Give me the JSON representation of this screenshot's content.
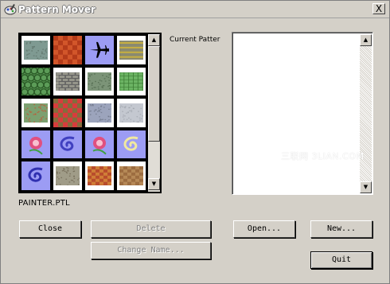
{
  "window": {
    "title": "Pattern Mover",
    "close_glyph": "X"
  },
  "patterns": {
    "items": [
      {
        "name": "stone-texture",
        "color": "#7f9a92",
        "accent": "#5d7068",
        "style": "speckle",
        "full": false
      },
      {
        "name": "red-rope",
        "color": "#d2562a",
        "accent": "#a02a10",
        "style": "weave",
        "full": true
      },
      {
        "name": "airplane-on-blue",
        "color": "#9c9cf4",
        "accent": "#000000",
        "style": "plane",
        "full": true
      },
      {
        "name": "road-stripes",
        "color": "#8a8a70",
        "accent": "#c8b040",
        "style": "stripes",
        "full": false
      },
      {
        "name": "green-scales",
        "color": "#5c9c58",
        "accent": "#2c5c28",
        "style": "scales",
        "full": true
      },
      {
        "name": "grey-bricks",
        "color": "#9c9c90",
        "accent": "#606060",
        "style": "bricks",
        "full": false
      },
      {
        "name": "grey-green-noise",
        "color": "#7c9478",
        "accent": "#4c6448",
        "style": "speckle",
        "full": false
      },
      {
        "name": "green-grid",
        "color": "#6cb464",
        "accent": "#3c7c34",
        "style": "grid",
        "full": false
      },
      {
        "name": "leaves-green",
        "color": "#7ca070",
        "accent": "#c85030",
        "style": "speckle",
        "full": false
      },
      {
        "name": "red-flowers",
        "color": "#d83c3c",
        "accent": "#4c8c3c",
        "style": "weave",
        "full": true
      },
      {
        "name": "blue-grey-fabric",
        "color": "#9ca4bc",
        "accent": "#6c7484",
        "style": "speckle",
        "full": false
      },
      {
        "name": "light-grey-plaster",
        "color": "#c4c8d0",
        "accent": "#a0a4ac",
        "style": "speckle",
        "full": false
      },
      {
        "name": "rose-on-blue",
        "color": "#9c9cf4",
        "accent": "#e05080",
        "style": "rose",
        "full": true
      },
      {
        "name": "swirl-on-blue",
        "color": "#9c9cf4",
        "accent": "#4040c0",
        "style": "swirl",
        "full": true
      },
      {
        "name": "rose-on-blue-2",
        "color": "#9c9cf4",
        "accent": "#e05080",
        "style": "rose",
        "full": true
      },
      {
        "name": "ribbon-on-blue",
        "color": "#9c9cf4",
        "accent": "#f0e8a0",
        "style": "swirl",
        "full": true
      },
      {
        "name": "swirl-on-blue-2",
        "color": "#9c9cf4",
        "accent": "#3030b0",
        "style": "swirl",
        "full": true
      },
      {
        "name": "tan-stone",
        "color": "#a09c88",
        "accent": "#6c6450",
        "style": "speckle",
        "full": false
      },
      {
        "name": "red-woven",
        "color": "#b84c2c",
        "accent": "#e0a040",
        "style": "weave",
        "full": false
      },
      {
        "name": "brown-rug",
        "color": "#9c6c40",
        "accent": "#c89c68",
        "style": "weave",
        "full": false
      }
    ],
    "scroll_up_glyph": "▲",
    "scroll_down_glyph": "▼"
  },
  "file": {
    "name": "PAINTER.PTL"
  },
  "current": {
    "label": "Current Patter"
  },
  "list": {
    "scroll_up_glyph": "▲",
    "scroll_down_glyph": "▼"
  },
  "buttons": {
    "close": "Close",
    "delete": "Delete",
    "change_name": "Change Name...",
    "open": "Open...",
    "new": "New...",
    "quit": "Quit"
  },
  "watermark": {
    "text": "三联网 3LIAN.COM"
  }
}
